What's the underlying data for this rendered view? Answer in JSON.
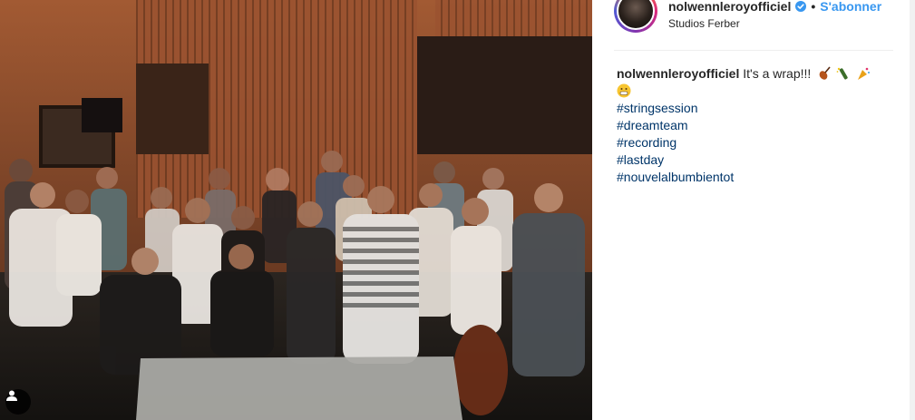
{
  "post": {
    "username": "nolwennleroyofficiel",
    "separator": "•",
    "follow_label": "S'abonner",
    "location": "Studios Ferber",
    "caption_text": "It's a wrap!!!",
    "caption_emojis": [
      "violin-emoji",
      "champagne-emoji",
      "party-popper-emoji",
      "grinning-face-emoji"
    ],
    "hashtags": [
      "#stringsession",
      "#dreamteam",
      "#recording",
      "#lastday",
      "#nouvelalbumbientot"
    ]
  },
  "photo": {
    "description_icon": "person-tag-icon"
  },
  "colors": {
    "link_blue": "#3897f0",
    "hashtag_blue": "#003569",
    "text": "#262626",
    "verified_blue": "#3897f0"
  }
}
